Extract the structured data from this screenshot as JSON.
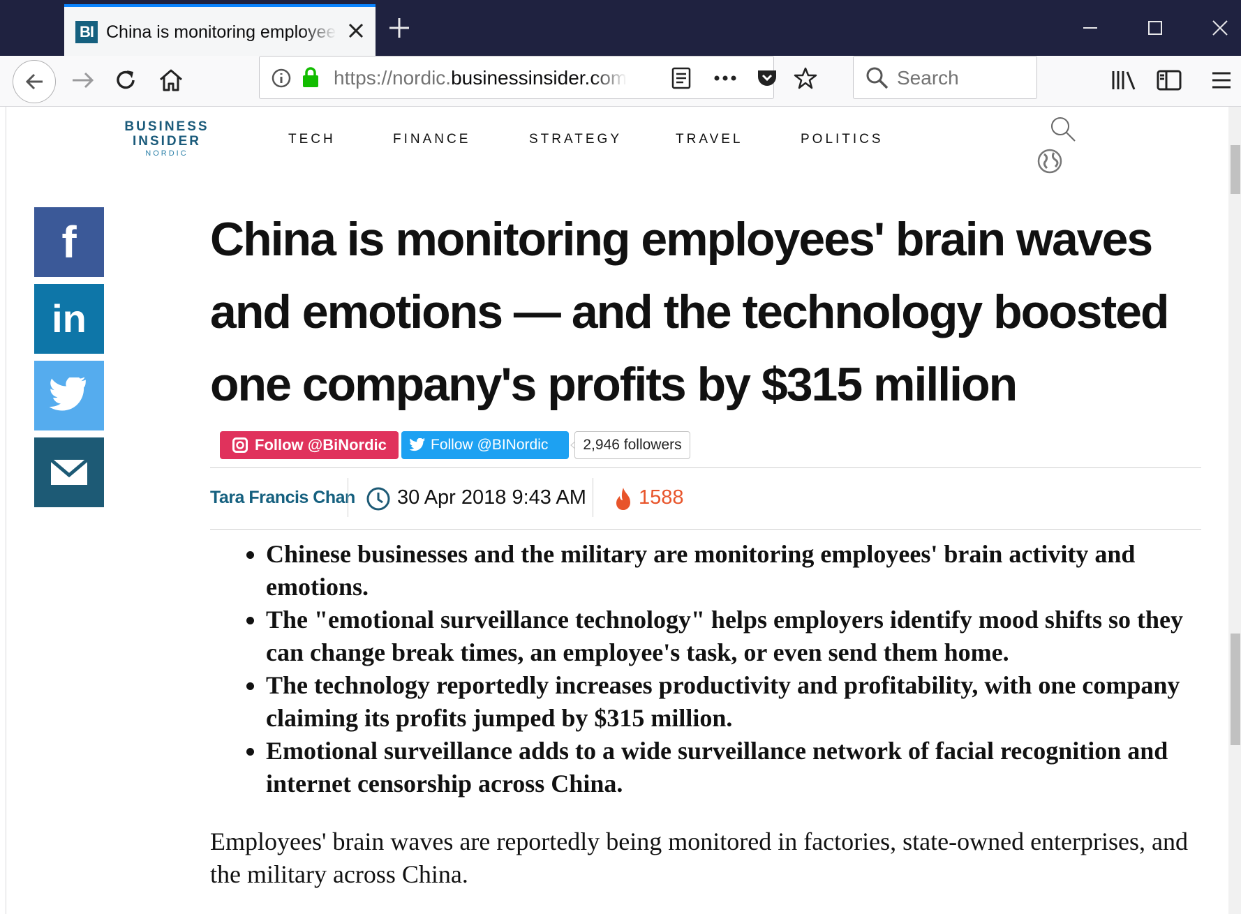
{
  "browser": {
    "tab_favicon_text": "BI",
    "tab_title": "China is monitoring employees' brain waves and emotions",
    "url_prefix": "https://nordic.",
    "url_host": "businessinsider.com",
    "search_placeholder": "Search"
  },
  "site": {
    "logo_line1": "BUSINESS",
    "logo_line2": "INSIDER",
    "logo_line3": "NORDIC",
    "nav": [
      "TECH",
      "FINANCE",
      "STRATEGY",
      "TRAVEL",
      "POLITICS"
    ]
  },
  "share": {
    "facebook": "f",
    "linkedin": "in"
  },
  "article": {
    "headline": "China is monitoring employees' brain waves and emotions — and the technology boosted one company's profits by $315 million",
    "instagram_follow": "Follow @BiNordic",
    "twitter_follow": "Follow @BINordic",
    "twitter_followers": "2,946 followers",
    "author": "Tara Francis Chan",
    "date": "30 Apr 2018 9:43 AM",
    "views": "1588",
    "summary": [
      "Chinese businesses and the military are monitoring employees' brain activity and emotions.",
      "The \"emotional surveillance technology\" helps employers identify mood shifts so they can change break times, an employee's task, or even send them home.",
      "The technology reportedly increases productivity and profitability, with one company claiming its profits jumped by $315 million.",
      "Emotional surveillance adds to a wide surveillance network of facial recognition and internet censorship across China."
    ],
    "body": "Employees' brain waves are reportedly being monitored in factories, state-owned enterprises, and the military across China."
  },
  "colors": {
    "titlebar": "#1f2240",
    "facebook": "#3b5998",
    "linkedin": "#0e76a8",
    "twitter": "#55acee",
    "email": "#1d5a75",
    "instagram": "#e0325c",
    "author": "#15607f",
    "views": "#e8542a"
  }
}
